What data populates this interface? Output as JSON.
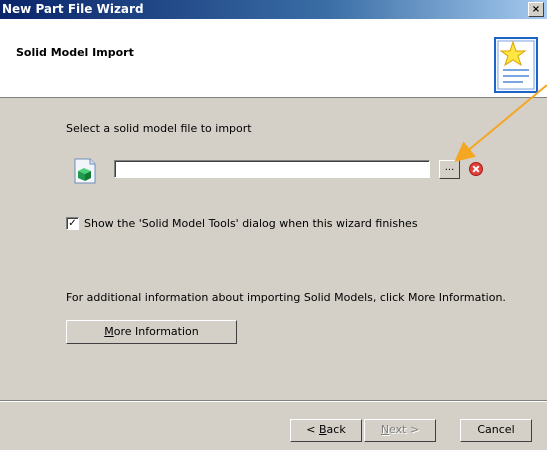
{
  "window": {
    "title": "New Part File Wizard",
    "close_label": "×"
  },
  "header": {
    "title": "Solid Model Import",
    "icon": "wizard-star-document-icon"
  },
  "main": {
    "instruction": "Select a solid model file to import",
    "file_input": {
      "value": "",
      "placeholder": ""
    },
    "browse_label": "...",
    "clear_icon": "red-x-clear-icon",
    "file_icon": "green-solid-model-icon",
    "checkbox": {
      "checked": true,
      "mark": "✓",
      "label": "Show the 'Solid Model Tools' dialog when this wizard finishes"
    },
    "info_text": "For additional information about importing Solid Models, click More Information.",
    "more_info": {
      "mnemonic": "M",
      "rest": "ore Information"
    }
  },
  "footer": {
    "back": {
      "prefix": "< ",
      "mnemonic": "B",
      "rest": "ack"
    },
    "next": {
      "mnemonic": "N",
      "rest": "ext >",
      "enabled": false
    },
    "cancel": "Cancel"
  },
  "colors": {
    "title_start": "#0a246a",
    "title_end": "#a6caf0",
    "dialog_bg": "#d4d0c8",
    "annotation_arrow": "#f5a623"
  }
}
